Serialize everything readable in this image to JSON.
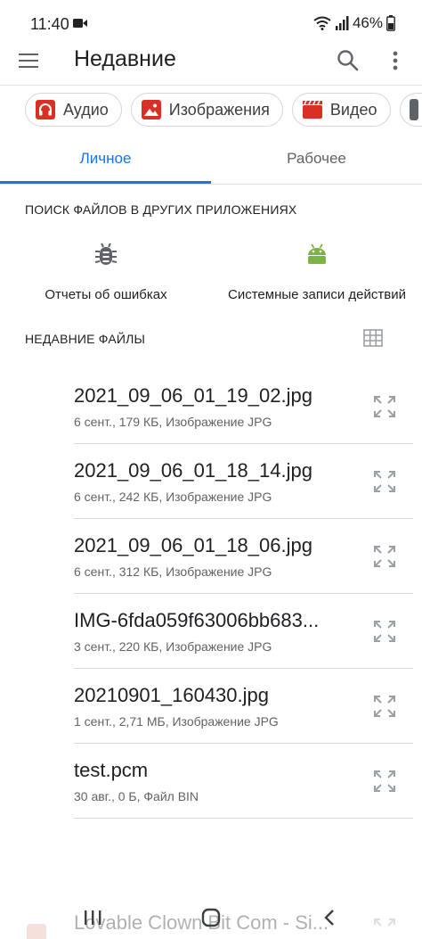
{
  "status": {
    "time": "11:40",
    "battery": "46%",
    "icons": [
      "video-record-icon",
      "wifi-icon",
      "signal-icon",
      "battery-icon"
    ]
  },
  "app_bar": {
    "title": "Недавние",
    "icons": [
      "menu-icon",
      "search-icon",
      "more-vert-icon"
    ]
  },
  "chips": [
    {
      "label": "Аудио",
      "icon": "headphones-icon",
      "color": "#d93025"
    },
    {
      "label": "Изображения",
      "icon": "image-icon",
      "color": "#d93025"
    },
    {
      "label": "Видео",
      "icon": "video-clapper-icon",
      "color": "#d93025"
    }
  ],
  "tabs": [
    {
      "label": "Личное",
      "active": true
    },
    {
      "label": "Рабочее",
      "active": false
    }
  ],
  "apps_section": {
    "title": "ПОИСК ФАЙЛОВ В ДРУГИХ ПРИЛОЖЕНИЯХ",
    "apps": [
      {
        "label": "Отчеты об ошибках",
        "icon": "bug-icon",
        "color": "#5f6368"
      },
      {
        "label": "Системные записи действий",
        "icon": "android-icon",
        "color": "#7cb342"
      }
    ]
  },
  "recent_section": {
    "title": "НЕДАВНИЕ ФАЙЛЫ",
    "view_icon": "grid-view-icon"
  },
  "files": [
    {
      "name": "2021_09_06_01_19_02.jpg",
      "meta": "6 сент., 179 КБ, Изображение JPG"
    },
    {
      "name": "2021_09_06_01_18_14.jpg",
      "meta": "6 сент., 242 КБ, Изображение JPG"
    },
    {
      "name": "2021_09_06_01_18_06.jpg",
      "meta": "6 сент., 312 КБ, Изображение JPG"
    },
    {
      "name": "IMG-6fda059f63006bb683...",
      "meta": "3 сент., 220 КБ, Изображение JPG"
    },
    {
      "name": "20210901_160430.jpg",
      "meta": "1 сент., 2,71 МБ, Изображение JPG"
    },
    {
      "name": "test.pcm",
      "meta": "30 авг., 0 Б, Файл BIN"
    }
  ],
  "peek_file": {
    "name": "Lovable Clown Bit Com - Si..."
  },
  "nav": [
    "recent-apps-icon",
    "home-icon",
    "back-icon"
  ],
  "colors": {
    "accent": "#1a73e8",
    "chip_icon": "#d93025",
    "android": "#7cb342"
  }
}
